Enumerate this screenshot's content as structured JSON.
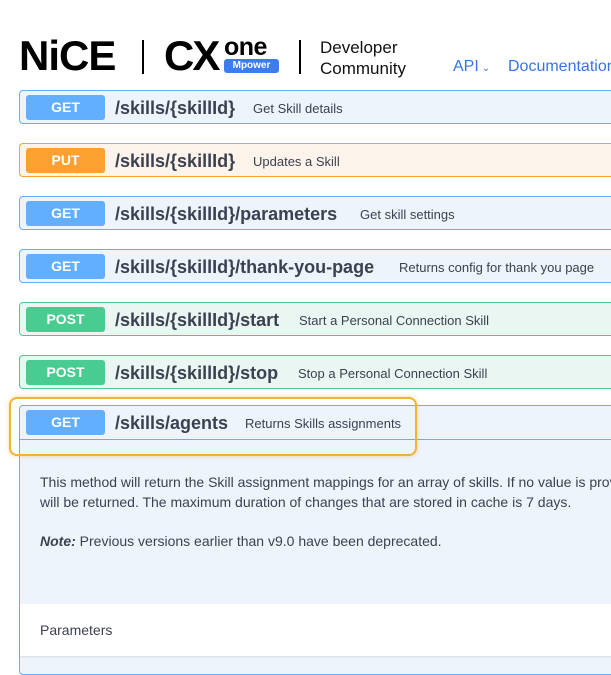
{
  "header": {
    "brand_nice": "NiCE",
    "brand_cx": "CX",
    "brand_one": "one",
    "brand_mpower": "Mpower",
    "title_line1": "Developer",
    "title_line2": "Community",
    "nav_api": "API",
    "nav_documentation": "Documentation"
  },
  "operations": [
    {
      "method": "GET",
      "path": "/skills/{skillId}",
      "description": "Get Skill details"
    },
    {
      "method": "PUT",
      "path": "/skills/{skillId}",
      "description": "Updates a Skill"
    },
    {
      "method": "GET",
      "path": "/skills/{skillId}/parameters",
      "description": "Get skill settings"
    },
    {
      "method": "GET",
      "path": "/skills/{skillId}/thank-you-page",
      "description": "Returns config for thank you page"
    },
    {
      "method": "POST",
      "path": "/skills/{skillId}/start",
      "description": "Start a Personal Connection Skill"
    },
    {
      "method": "POST",
      "path": "/skills/{skillId}/stop",
      "description": "Stop a Personal Connection Skill"
    }
  ],
  "expanded": {
    "method": "GET",
    "path": "/skills/agents",
    "description": "Returns Skills assignments",
    "body_line1": "This method will return the Skill assignment mappings for an array of skills. If no value is prov",
    "body_line2": "will be returned. The maximum duration of changes that are stored in cache is 7 days.",
    "note_label": "Note:",
    "note_text": " Previous versions earlier than v9.0 have been deprecated.",
    "parameters_label": "Parameters"
  },
  "colors": {
    "get": "#61affe",
    "put": "#fca130",
    "post": "#49cc90",
    "highlight": "#f2b233",
    "link": "#3774e4"
  }
}
